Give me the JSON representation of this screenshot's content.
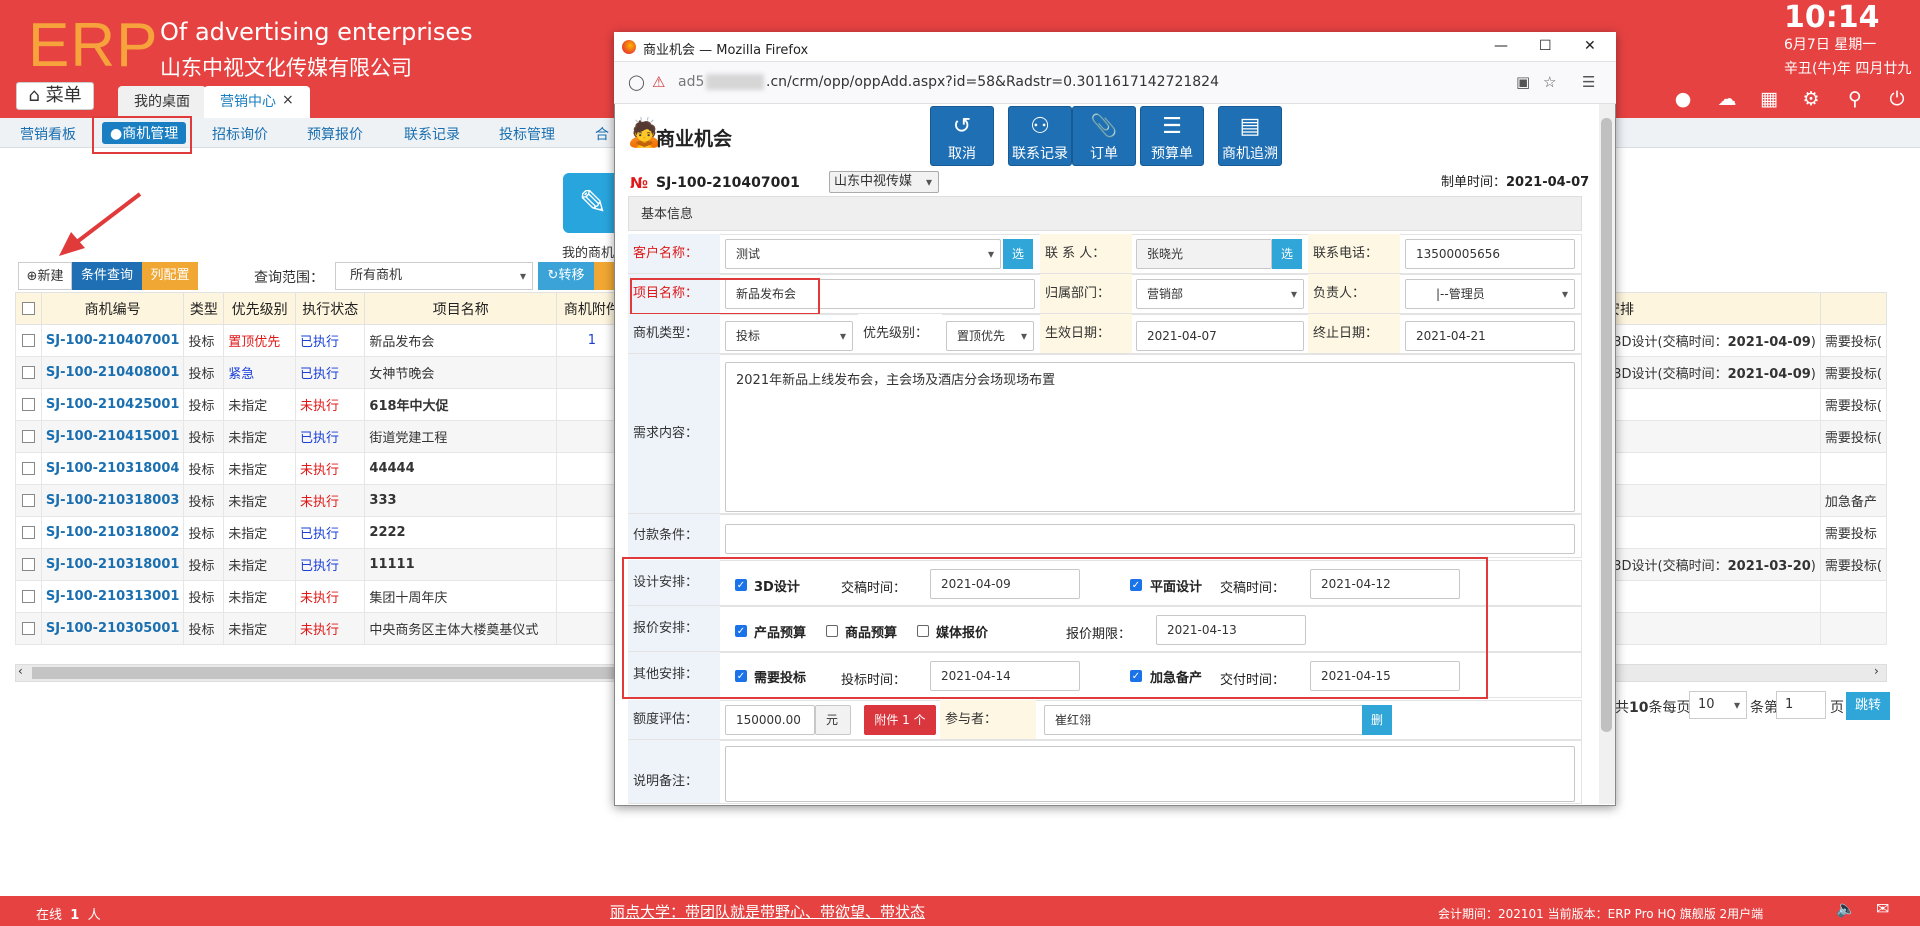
{
  "header": {
    "logo": "ERP",
    "slogan": "Of advertising enterprises",
    "company": "山东中视文化传媒有限公司",
    "time": "10:14",
    "date": "6月7日 星期一",
    "lunar": "辛丑(牛)年 四月廿九",
    "menu_label": "菜单",
    "tabs": [
      "我的桌面",
      "营销中心"
    ],
    "tab_close": "×"
  },
  "subnav": [
    "营销看板",
    "●商机管理",
    "招标询价",
    "预算报价",
    "联系记录",
    "投标管理",
    "合"
  ],
  "list_panel": {
    "center_label": "我的商机",
    "btn_new": "新建",
    "btn_query": "条件查询",
    "btn_cols": "列配置",
    "scope_label": "查询范围：",
    "scope_value": "所有商机",
    "btn_transfer": "转移",
    "columns": [
      "商机编号",
      "类型",
      "优先级别",
      "执行状态",
      "项目名称",
      "商机附件"
    ],
    "right_column": "安排",
    "rows": [
      {
        "code": "SJ-100-210407001",
        "type": "投标",
        "priority": "置顶优先",
        "status": "已执行",
        "name": "新品发布会",
        "attach": "1",
        "arr": "L3D设计(交稿时间：2021-04-09)",
        "extra": "需要投标("
      },
      {
        "code": "SJ-100-210408001",
        "type": "投标",
        "priority": "紧急",
        "status": "已执行",
        "name": "女神节晚会",
        "attach": "",
        "arr": "L3D设计(交稿时间：2021-04-09)",
        "extra": "需要投标("
      },
      {
        "code": "SJ-100-210425001",
        "type": "投标",
        "priority": "未指定",
        "status": "未执行",
        "name": "618年中大促",
        "attach": "",
        "arr": "",
        "extra": "需要投标("
      },
      {
        "code": "SJ-100-210415001",
        "type": "投标",
        "priority": "未指定",
        "status": "已执行",
        "name": "街道党建工程",
        "attach": "",
        "arr": "",
        "extra": "需要投标("
      },
      {
        "code": "SJ-100-210318004",
        "type": "投标",
        "priority": "未指定",
        "status": "未执行",
        "name": "44444",
        "attach": "",
        "arr": "",
        "extra": ""
      },
      {
        "code": "SJ-100-210318003",
        "type": "投标",
        "priority": "未指定",
        "status": "未执行",
        "name": "333",
        "attach": "",
        "arr": "",
        "extra": "加急备产"
      },
      {
        "code": "SJ-100-210318002",
        "type": "投标",
        "priority": "未指定",
        "status": "已执行",
        "name": "2222",
        "attach": "",
        "arr": "",
        "extra": "需要投标"
      },
      {
        "code": "SJ-100-210318001",
        "type": "投标",
        "priority": "未指定",
        "status": "已执行",
        "name": "11111",
        "attach": "",
        "arr": "L3D设计(交稿时间：2021-03-20)",
        "extra": "需要投标("
      },
      {
        "code": "SJ-100-210313001",
        "type": "投标",
        "priority": "未指定",
        "status": "未执行",
        "name": "集团十周年庆",
        "attach": "",
        "arr": "",
        "extra": ""
      },
      {
        "code": "SJ-100-210305001",
        "type": "投标",
        "priority": "未指定",
        "status": "未执行",
        "name": "中央商务区主体大楼奠基仪式",
        "attach": "",
        "arr": "",
        "extra": ""
      }
    ],
    "pager": {
      "text1": "共",
      "total": "10",
      "text2": "条每页",
      "per_page": "10",
      "text3": "条第",
      "page": "1",
      "text4": "页",
      "go": "跳转"
    }
  },
  "footer": {
    "online_label": "在线",
    "online_count": "1",
    "online_unit": "人",
    "motto": "丽点大学：带团队就是带野心、带欲望、带状态",
    "version": "会计期间：202101 当前版本：ERP Pro HQ 旗舰版 2用户端"
  },
  "browser": {
    "title": "商业机会 — Mozilla Firefox",
    "url_host": "ad5",
    "url_rest": ".cn/crm/opp/oppAdd.aspx?id=58&Radstr=0.3011617142721824"
  },
  "form": {
    "title": "商业机会",
    "actions": [
      "取消",
      "联系记录",
      "订单",
      "预算单",
      "商机追溯"
    ],
    "number": "SJ-100-210407001",
    "company_select": "山东中视传媒",
    "made_time_label": "制单时间：",
    "made_time": "2021-04-07",
    "section": "基本信息",
    "customer_label": "客户名称：",
    "customer": "测试",
    "select_btn": "选",
    "contact_label": "联 系 人：",
    "contact": "张晓光",
    "phone_label": "联系电话：",
    "phone": "13500005656",
    "project_label": "项目名称：",
    "project": "新品发布会",
    "dept_label": "归属部门：",
    "dept": "营销部",
    "owner_label": "负责人：",
    "owner": "|--管理员",
    "type_label": "商机类型：",
    "type": "投标",
    "priority_label": "优先级别：",
    "priority": "置顶优先",
    "start_label": "生效日期：",
    "start": "2021-04-07",
    "end_label": "终止日期：",
    "end": "2021-04-21",
    "need_label": "需求内容：",
    "need": "2021年新品上线发布会，主会场及酒店分会场现场布置",
    "pay_label": "付款条件：",
    "design_label": "设计安排：",
    "design_3d": "3D设计",
    "design_flat": "平面设计",
    "deliver_label": "交稿时间：",
    "design_3d_date": "2021-04-09",
    "design_flat_date": "2021-04-12",
    "quote_label": "报价安排：",
    "quote_product": "产品预算",
    "quote_goods": "商品预算",
    "quote_media": "媒体报价",
    "quote_deadline_label": "报价期限：",
    "quote_deadline": "2021-04-13",
    "other_label": "其他安排：",
    "other_bid": "需要投标",
    "bid_time_label": "投标时间：",
    "bid_time": "2021-04-14",
    "other_urgent": "加急备产",
    "delivery_label": "交付时间：",
    "delivery": "2021-04-15",
    "amount_label": "额度评估：",
    "amount": "150000.00",
    "amount_unit": "元",
    "attach_btn": "附件 1 个",
    "participant_label": "参与者：",
    "participant": "崔红翎",
    "delete_btn": "删",
    "remark_label": "说明备注："
  }
}
